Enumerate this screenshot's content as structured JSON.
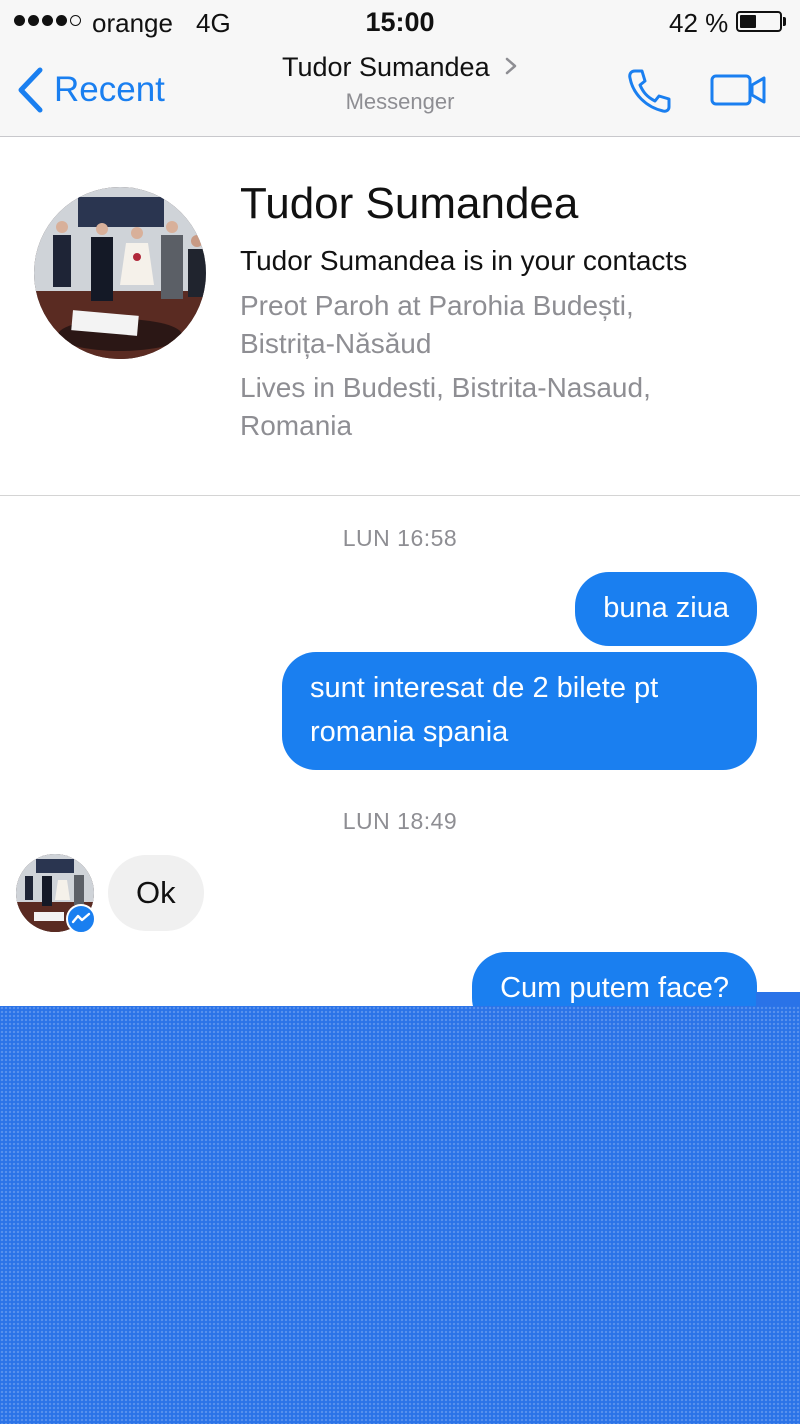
{
  "status_bar": {
    "carrier": "orange",
    "network": "4G",
    "time": "15:00",
    "battery_percent": "42 %",
    "battery_level": 0.42,
    "signal_bars_filled": 4,
    "signal_bars_total": 5
  },
  "nav": {
    "back_label": "Recent",
    "title": "Tudor Sumandea",
    "subtitle": "Messenger",
    "accent_color": "#1a7ff0",
    "icons": [
      "chevron-left-icon",
      "chevron-right-icon",
      "phone-icon",
      "video-camera-icon"
    ]
  },
  "contact": {
    "name": "Tudor Sumandea",
    "contacts_note": "Tudor Sumandea is in your contacts",
    "work_line1": "Preot Paroh at Parohia Budești,",
    "work_line2": "Bistrița-Năsăud",
    "lives_line1": "Lives in Budesti, Bistrita-Nasaud,",
    "lives_line2": "Romania"
  },
  "conversation": {
    "timestamp1": "LUN 16:58",
    "msg1": "buna ziua",
    "msg2_line1": "sunt interesat de 2 bilete pt",
    "msg2_line2": "romania spania",
    "timestamp2": "LUN 18:49",
    "reply": "Ok",
    "msg3": "Cum putem face?"
  },
  "colors": {
    "outgoing_bubble": "#1a7ff0",
    "incoming_bubble": "#f0f0f0",
    "redaction_overlay": "#2a73e8"
  }
}
